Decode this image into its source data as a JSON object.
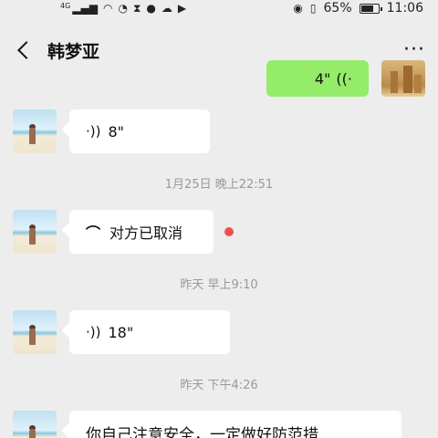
{
  "status_bar": {
    "network_label": "4G",
    "battery_percent": "65%",
    "time": "11:06"
  },
  "header": {
    "title": "韩梦亚",
    "more_label": "···"
  },
  "messages": {
    "outgoing_voice": {
      "duration": "4\""
    },
    "voice_1": {
      "duration": "8\""
    },
    "time_1": "1月25日 晚上22:51",
    "call_cancelled": {
      "text": "对方已取消"
    },
    "time_2": "昨天 早上9:10",
    "voice_2": {
      "duration": "18\""
    },
    "time_3": "昨天 下午4:26",
    "text_1": {
      "text": "你自己注意安全，一定做好防范措"
    }
  },
  "colors": {
    "background": "#ededed",
    "incoming_bubble": "#ffffff",
    "outgoing_bubble": "#95ec69",
    "unread_dot": "#f05050",
    "timestamp": "#999999"
  },
  "icons": {
    "back": "chevron-left-icon",
    "more": "more-dots-icon",
    "voice": "voice-wave-icon",
    "hangup": "phone-hangup-icon"
  }
}
